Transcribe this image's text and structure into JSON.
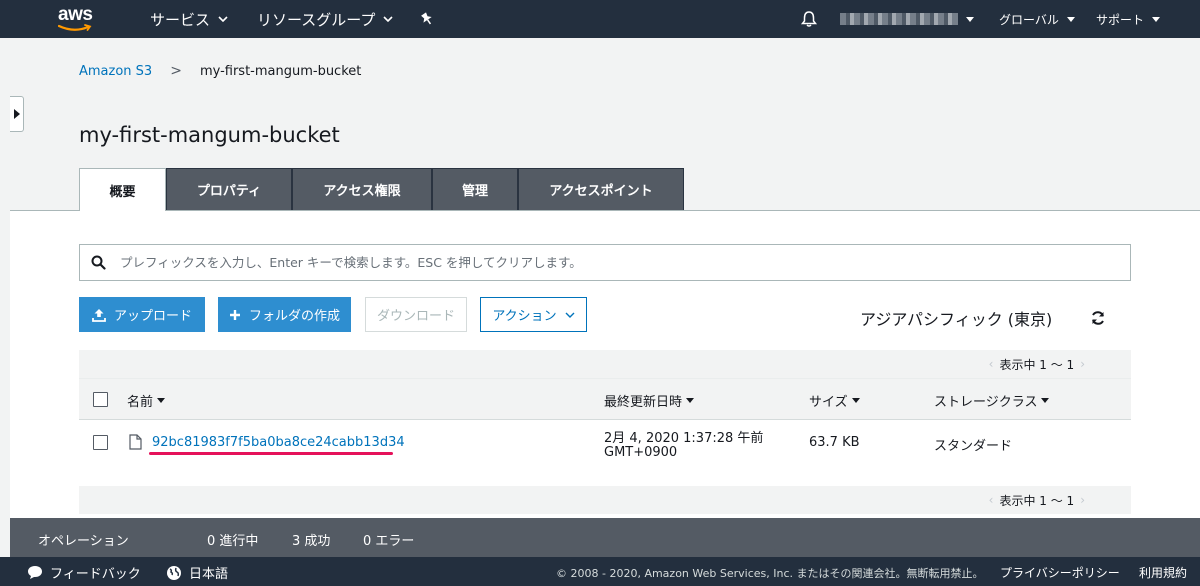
{
  "topnav": {
    "logo_text": "aws",
    "services": "サービス",
    "resource_groups": "リソースグループ",
    "region_menu": "グローバル",
    "support_menu": "サポート"
  },
  "breadcrumb": {
    "root": "Amazon S3",
    "separator": ">",
    "current": "my-first-mangum-bucket"
  },
  "page_title": "my-first-mangum-bucket",
  "tabs": [
    {
      "label": "概要",
      "active": true
    },
    {
      "label": "プロパティ",
      "active": false
    },
    {
      "label": "アクセス権限",
      "active": false
    },
    {
      "label": "管理",
      "active": false
    },
    {
      "label": "アクセスポイント",
      "active": false
    }
  ],
  "search": {
    "placeholder": "プレフィックスを入力し、Enter キーで検索します。ESC を押してクリアします。"
  },
  "toolbar": {
    "upload": "アップロード",
    "create_folder": "フォルダの作成",
    "download": "ダウンロード",
    "actions": "アクション",
    "region": "アジアパシフィック (東京)"
  },
  "pager": {
    "text": "表示中 1 ～ 1",
    "prev": "‹",
    "next": "›"
  },
  "table": {
    "headers": {
      "name": "名前",
      "last_modified": "最終更新日時",
      "size": "サイズ",
      "storage_class": "ストレージクラス"
    },
    "rows": [
      {
        "name": "92bc81983f7f5ba0ba8ce24cabb13d34",
        "last_modified_line1": "2月 4, 2020 1:37:28 午前",
        "last_modified_line2": "GMT+0900",
        "size": "63.7 KB",
        "storage_class": "スタンダード"
      }
    ]
  },
  "operations": {
    "label": "オペレーション",
    "in_progress": "0 進行中",
    "success": "3 成功",
    "errors": "0 エラー"
  },
  "footer": {
    "feedback": "フィードバック",
    "language": "日本語",
    "copyright": "© 2008 - 2020, Amazon Web Services, Inc. またはその関連会社。無断転用禁止。",
    "privacy": "プライバシーポリシー",
    "terms": "利用規約"
  },
  "colors": {
    "nav_bg": "#232f3e",
    "link": "#0073bb",
    "primary_button": "#2e8ed0",
    "tab_inactive": "#545b64",
    "highlight_underline": "#e5115a"
  }
}
